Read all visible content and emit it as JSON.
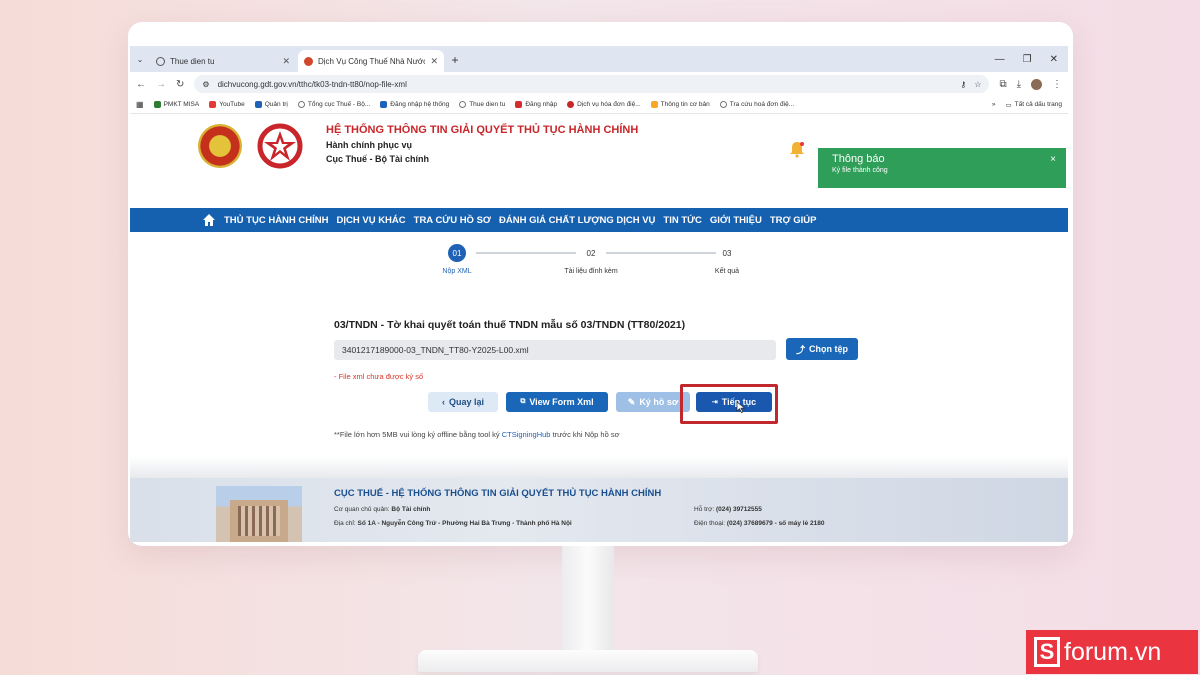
{
  "browser": {
    "tabs": [
      {
        "title": "Thue dien tu",
        "active": false
      },
      {
        "title": "Dịch Vụ Công Thuế Nhà Nước",
        "active": true
      }
    ],
    "new_tab_label": "+",
    "url": "dichvucong.gdt.gov.vn/tthc/tk03-tndn-tt80/nop-file-xml",
    "bookmarks": [
      {
        "label": "PMKT MISA",
        "color": "#2e7d32"
      },
      {
        "label": "YouTube",
        "color": "#e53935"
      },
      {
        "label": "Quản trị",
        "color": "#1e63b8"
      },
      {
        "label": "Tổng cục Thuế - Bộ...",
        "color": "#777777"
      },
      {
        "label": "Đăng nhập hệ thống",
        "color": "#1e63b8"
      },
      {
        "label": "Thue dien tu",
        "color": "#777777"
      },
      {
        "label": "Đăng nhập",
        "color": "#d32f2f"
      },
      {
        "label": "Dịch vụ hóa đơn điệ...",
        "color": "#c62828"
      },
      {
        "label": "Thông tin cơ bản",
        "color": "#f9a825"
      },
      {
        "label": "Tra cứu hoá đơn điệ...",
        "color": "#777777"
      }
    ],
    "bookmarks_overflow": "»",
    "all_bookmarks": "Tất cả dấu trang"
  },
  "header": {
    "title": "HỆ THỐNG THÔNG TIN GIẢI QUYẾT THỦ TỤC HÀNH CHÍNH",
    "subtitle1": "Hành chính phục vụ",
    "subtitle2": "Cục Thuế - Bộ Tài chính"
  },
  "toast": {
    "title": "Thông báo",
    "message": "Ký file thành công",
    "close": "×"
  },
  "nav": {
    "items": [
      "THỦ TỤC HÀNH CHÍNH",
      "DỊCH VỤ KHÁC",
      "TRA CỨU HỒ SƠ",
      "ĐÁNH GIÁ CHẤT LƯỢNG DỊCH VỤ",
      "TIN TỨC",
      "GIỚI THIỆU",
      "TRỢ GIÚP"
    ]
  },
  "steps": [
    {
      "number": "01",
      "label": "Nộp XML",
      "active": true
    },
    {
      "number": "02",
      "label": "Tài liệu đính kèm",
      "active": false
    },
    {
      "number": "03",
      "label": "Kết quả",
      "active": false
    }
  ],
  "form": {
    "title": "03/TNDN - Tờ khai quyết toán thuế TNDN mẫu số 03/TNDN (TT80/2021)",
    "file_name": "3401217189000-03_TNDN_TT80-Y2025-L00.xml",
    "choose_file": "Chọn tệp",
    "error": "- File xml chưa được ký số",
    "buttons": {
      "back": "Quay lại",
      "view_form": "View Form Xml",
      "sign": "Ký hồ sơ",
      "continue": "Tiếp tục"
    },
    "note_prefix": "**File lớn hơn 5MB vui lòng ký offline bằng tool ký ",
    "note_link": "CTSigningHub",
    "note_suffix": " trước khi Nộp hồ sơ"
  },
  "footer": {
    "title": "CỤC THUẾ - HỆ THỐNG THÔNG TIN GIẢI QUYẾT THỦ TỤC HÀNH CHÍNH",
    "agency_label": "Cơ quan chủ quản:",
    "agency": "Bộ Tài chính",
    "address_label": "Địa chỉ:",
    "address": "Số 1A - Nguyễn Công Trứ - Phường Hai Bà Trưng - Thành phố Hà Nội",
    "support_label": "Hỗ trợ:",
    "support": "(024) 39712555",
    "phone_label": "Điện thoại:",
    "phone": "(024) 37689679 - số máy lẻ 2180"
  },
  "watermark": {
    "logo_letter": "S",
    "text": "forum.vn"
  },
  "colors": {
    "nav_blue": "#1660b0",
    "toast_green": "#2e9e58",
    "highlight_red": "#c1272d",
    "watermark_red": "#ea3440"
  }
}
